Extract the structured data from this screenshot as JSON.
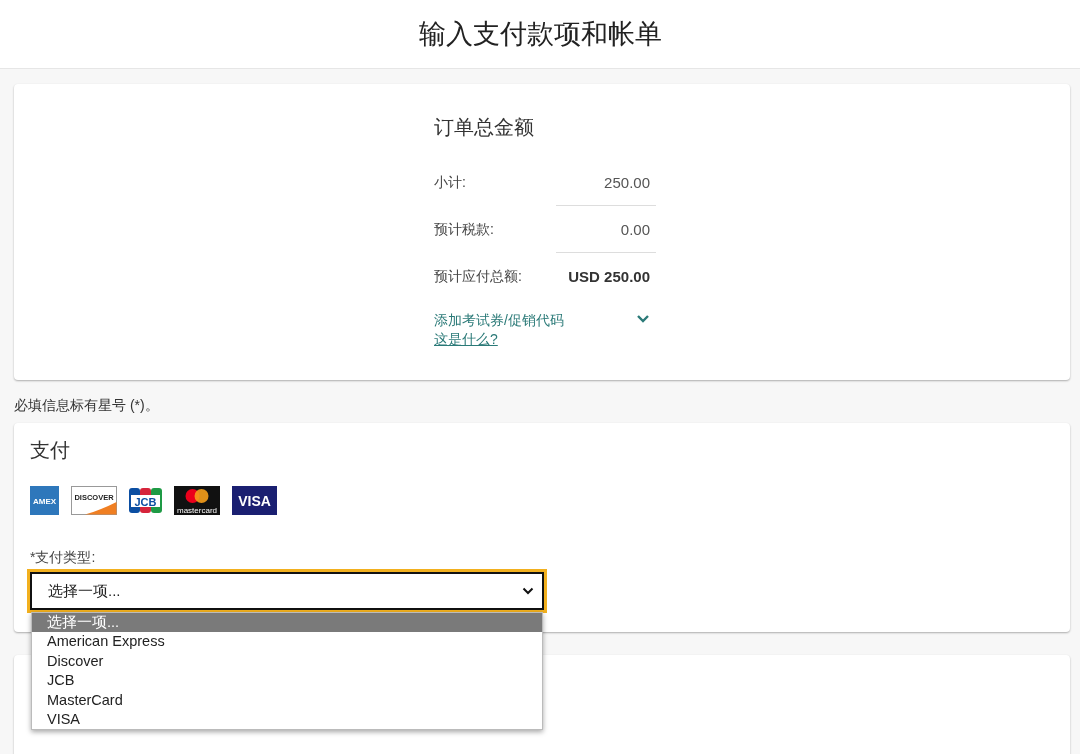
{
  "header": {
    "title": "输入支付款项和帐单"
  },
  "order_summary": {
    "title": "订单总金额",
    "rows": [
      {
        "label": "小计:",
        "value": "250.00",
        "kind": "line"
      },
      {
        "label": "预计税款:",
        "value": "0.00",
        "kind": "line"
      },
      {
        "label": "预计应付总额:",
        "value": "USD 250.00",
        "kind": "total"
      }
    ],
    "promo": {
      "label": "添加考试券/促销代码",
      "expanded": false,
      "help_link": "这是什么?"
    }
  },
  "required_note": "必填信息标有星号 (*)。",
  "payment": {
    "title": "支付",
    "card_logos": [
      {
        "kind": "amex",
        "label": "AMEX"
      },
      {
        "kind": "discover",
        "label": "DISCOVER"
      },
      {
        "kind": "jcb",
        "label": "JCB"
      },
      {
        "kind": "mastercard",
        "label": "mastercard"
      },
      {
        "kind": "visa",
        "label": "VISA"
      }
    ],
    "type_field": {
      "label": "*支付类型:",
      "value": "选择一项...",
      "expanded": true,
      "options": [
        {
          "label": "选择一项...",
          "selected": true
        },
        {
          "label": "American Express",
          "selected": false
        },
        {
          "label": "Discover",
          "selected": false
        },
        {
          "label": "JCB",
          "selected": false
        },
        {
          "label": "MasterCard",
          "selected": false
        },
        {
          "label": "VISA",
          "selected": false
        }
      ]
    }
  }
}
